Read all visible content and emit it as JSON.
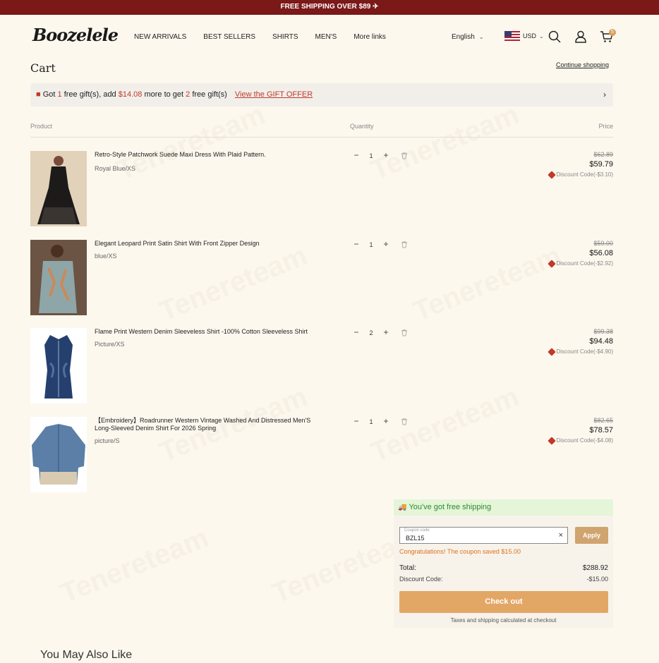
{
  "topbar": {
    "text": "FREE SHIPPING OVER $89 ✈"
  },
  "header": {
    "logo": "Boozelele",
    "nav": [
      "NEW ARRIVALS",
      "BEST SELLERS",
      "SHIRTS",
      "MEN'S",
      "More links"
    ],
    "language": "English",
    "currency": "USD",
    "cart_count": "5"
  },
  "cart": {
    "title": "Cart",
    "continue_label": "Continue shopping",
    "gift": {
      "pre": "Got ",
      "got": "1",
      "mid1": " free gift(s), add ",
      "amount": "$14.08",
      "mid2": " more to get ",
      "next": "2",
      "post": " free gift(s)",
      "link": "View the GIFT OFFER"
    },
    "columns": {
      "product": "Product",
      "quantity": "Quantity",
      "price": "Price"
    },
    "items": [
      {
        "title": "Retro-Style Patchwork Suede Maxi Dress With Plaid Pattern.",
        "variant": "Royal Blue/XS",
        "qty": "1",
        "old_price": "$62.89",
        "price": "$59.79",
        "discount": "Discount Code(-$3.10)"
      },
      {
        "title": "Elegant Leopard Print Satin Shirt With Front Zipper Design",
        "variant": "blue/XS",
        "qty": "1",
        "old_price": "$59.00",
        "price": "$56.08",
        "discount": "Discount Code(-$2.92)"
      },
      {
        "title": "Flame Print Western Denim Sleeveless Shirt -100% Cotton Sleeveless Shirt",
        "variant": "Picture/XS",
        "qty": "2",
        "old_price": "$99.38",
        "price": "$94.48",
        "discount": "Discount Code(-$4.90)"
      },
      {
        "title": "【Embroidery】Roadrunner Western Vintage Washed And Distressed Men'S Long-Sleeved Denim Shirt For 2026 Spring",
        "variant": "picture/S",
        "qty": "1",
        "old_price": "$82.65",
        "price": "$78.57",
        "discount": "Discount Code(-$4.08)"
      }
    ]
  },
  "summary": {
    "free_shipping": "You've got free shipping",
    "coupon_label": "Coupon code",
    "coupon_value": "BZL15",
    "apply_label": "Apply",
    "congrats": "Congratulations!  The coupon saved $15.00",
    "total_label": "Total:",
    "total_value": "$288.92",
    "discount_label": "Discount Code:",
    "discount_value": "-$15.00",
    "checkout_label": "Check out",
    "note": "Taxes and shipping calculated at checkout"
  },
  "recommend": {
    "title": "You May Also Like"
  },
  "watermark": "Tenereteam",
  "colors": {
    "topbar": "#7b1818",
    "accent": "#e3a765",
    "apply": "#cfa46f",
    "sale_red": "#c0392b",
    "success_green": "#2f8a2f"
  }
}
